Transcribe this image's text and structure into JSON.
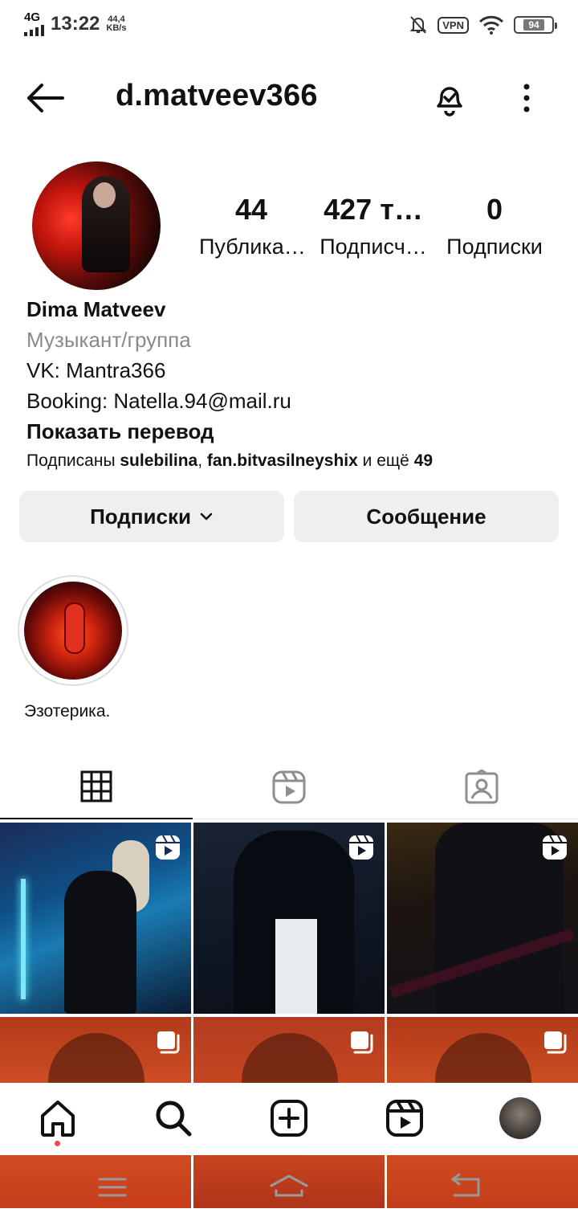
{
  "status_bar": {
    "network": "4G",
    "time": "13:22",
    "speed_value": "44,4",
    "speed_unit": "KB/s",
    "vpn": "VPN",
    "battery": "94"
  },
  "header": {
    "username": "d.matveev366",
    "icons": [
      "back-arrow-icon",
      "bell-check-icon",
      "more-vertical-icon"
    ]
  },
  "profile": {
    "stats": [
      {
        "value": "44",
        "label": "Публика…"
      },
      {
        "value": "427 т…",
        "label": "Подписч…"
      },
      {
        "value": "0",
        "label": "Подписки"
      }
    ],
    "name": "Dima Matveev",
    "category": "Музыкант/группа",
    "bio_lines": [
      "VK: Mantra366",
      "Booking: Natella.94@mail.ru"
    ],
    "translate": "Показать перевод",
    "followed_by": {
      "prefix": "Подписаны ",
      "user1": "sulebilina",
      "sep": ", ",
      "user2": "fan.bitvasilneyshix",
      "more_text": " и ещё ",
      "more_count": "49"
    }
  },
  "actions": {
    "following": "Подписки",
    "message": "Сообщение"
  },
  "highlights": [
    {
      "label": "Эзотерика."
    }
  ],
  "tabs": [
    "grid-icon",
    "reels-icon",
    "tagged-icon"
  ],
  "posts": [
    {
      "type": "reel"
    },
    {
      "type": "reel"
    },
    {
      "type": "reel"
    },
    {
      "type": "carousel"
    },
    {
      "type": "carousel"
    },
    {
      "type": "carousel"
    }
  ],
  "bottom_nav": [
    "home-icon",
    "search-icon",
    "add-post-icon",
    "reels-icon",
    "profile-avatar"
  ],
  "colors": {
    "notification_dot": "#ed4956",
    "button_bg": "#efefef",
    "secondary_text": "#8a8a8a"
  }
}
